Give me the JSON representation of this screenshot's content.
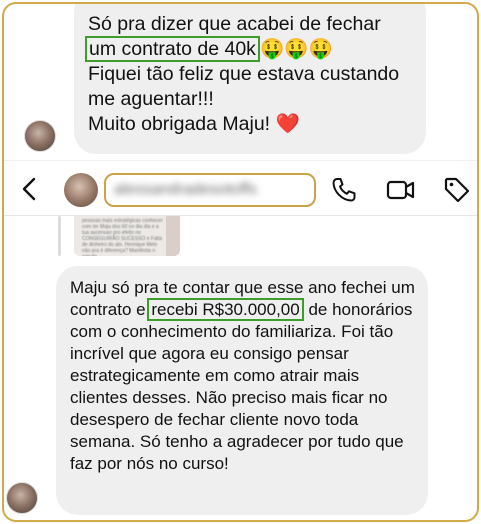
{
  "message_top": {
    "line1": "Só pra dizer que acabei de fechar",
    "highlight": "um contrato de 40k",
    "emojis": "🤑🤑🤑",
    "line3": "Fiquei tão feliz que estava custando me aguentar!!!",
    "line4": "Muito obrigada Maju!",
    "heart": "❤️"
  },
  "header": {
    "contact_name": "alessandradesotoffs",
    "back_icon": "chevron-left-icon",
    "call_icon": "phone-icon",
    "video_icon": "video-camera-icon",
    "tag_icon": "tag-icon"
  },
  "shared_post": {
    "preview_text": "pessoas mais estratégicas conhecer com ter Maju dos 60 no dia dia e a tua ascensao pro efeito no CONSEGUIRÃO SUCESSO e Falta de dinheiro do ato. Henrique Melo não pra é diferença? Manifesta o estudo."
  },
  "message_bottom": {
    "before": "Maju só pra te contar que esse ano fechei um contrato e ",
    "highlight": "recebi R$30.000,00",
    "after": " de honorários com o conhecimento do familiariza. Foi tão incrível que agora eu consigo pensar estrategicamente em como atrair mais clientes desses. Não preciso mais ficar no desespero de fechar cliente novo toda semana. Só tenho a agradecer por tudo que faz por nós no curso!"
  },
  "colors": {
    "bubble": "#efefef",
    "highlight_border": "#3f9e2b",
    "frame_border": "#d4a94a",
    "name_box_border": "#c9a24a"
  }
}
